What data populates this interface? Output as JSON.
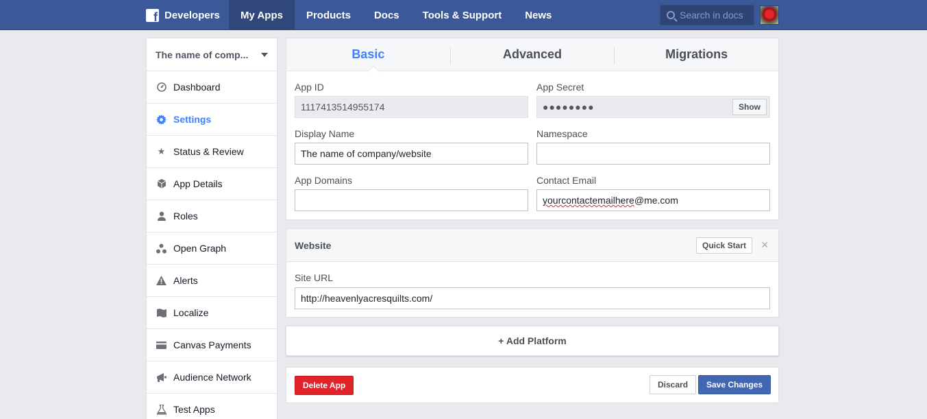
{
  "topbar": {
    "brand": "Developers",
    "nav": [
      "My Apps",
      "Products",
      "Docs",
      "Tools & Support",
      "News"
    ],
    "search_placeholder": "Search in docs"
  },
  "sidebar": {
    "app_name": "The name of comp...",
    "items": [
      {
        "label": "Dashboard",
        "icon": "dashboard-icon"
      },
      {
        "label": "Settings",
        "icon": "gear-icon"
      },
      {
        "label": "Status & Review",
        "icon": "star-icon"
      },
      {
        "label": "App Details",
        "icon": "cube-icon"
      },
      {
        "label": "Roles",
        "icon": "person-icon"
      },
      {
        "label": "Open Graph",
        "icon": "graph-icon"
      },
      {
        "label": "Alerts",
        "icon": "warning-icon"
      },
      {
        "label": "Localize",
        "icon": "map-icon"
      },
      {
        "label": "Canvas Payments",
        "icon": "card-icon"
      },
      {
        "label": "Audience Network",
        "icon": "megaphone-icon"
      },
      {
        "label": "Test Apps",
        "icon": "flask-icon"
      }
    ]
  },
  "tabs": [
    "Basic",
    "Advanced",
    "Migrations"
  ],
  "basic": {
    "app_id_label": "App ID",
    "app_id": "1117413514955174",
    "app_secret_label": "App Secret",
    "app_secret": "●●●●●●●●",
    "show_label": "Show",
    "display_name_label": "Display Name",
    "display_name": "The name of company/website",
    "namespace_label": "Namespace",
    "namespace": "",
    "app_domains_label": "App Domains",
    "app_domains": "",
    "contact_email_label": "Contact Email",
    "contact_email_user": "yourcontactemailhere",
    "contact_email_domain": "@me.com"
  },
  "website": {
    "title": "Website",
    "quick_start": "Quick Start",
    "close": "×",
    "site_url_label": "Site URL",
    "site_url": "http://heavenlyacresquilts.com/"
  },
  "add_platform": "+ Add Platform",
  "actions": {
    "delete": "Delete App",
    "discard": "Discard",
    "save": "Save Changes"
  }
}
